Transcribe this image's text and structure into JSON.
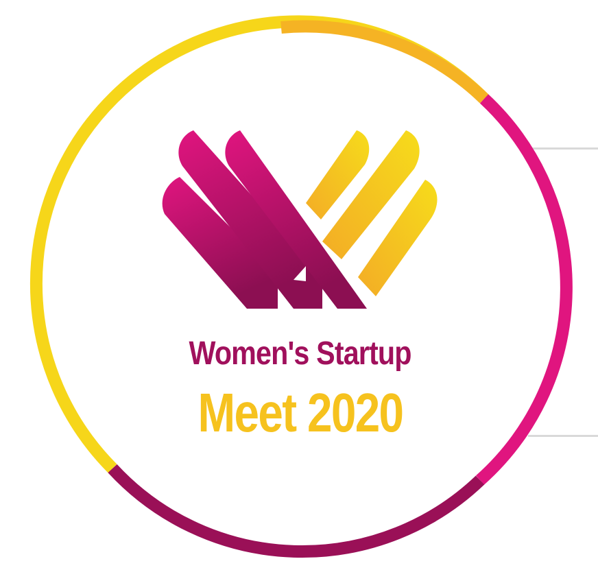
{
  "logo": {
    "line1": "Women's Startup",
    "line2": "Meet 2020"
  },
  "colors": {
    "magenta": "#e0157f",
    "purple": "#9a1057",
    "yellow": "#f6d61a",
    "orange": "#f5b324",
    "line1_text": "#a0105c",
    "line2_text": "#f6c21e",
    "divider": "#d9d9d9"
  }
}
